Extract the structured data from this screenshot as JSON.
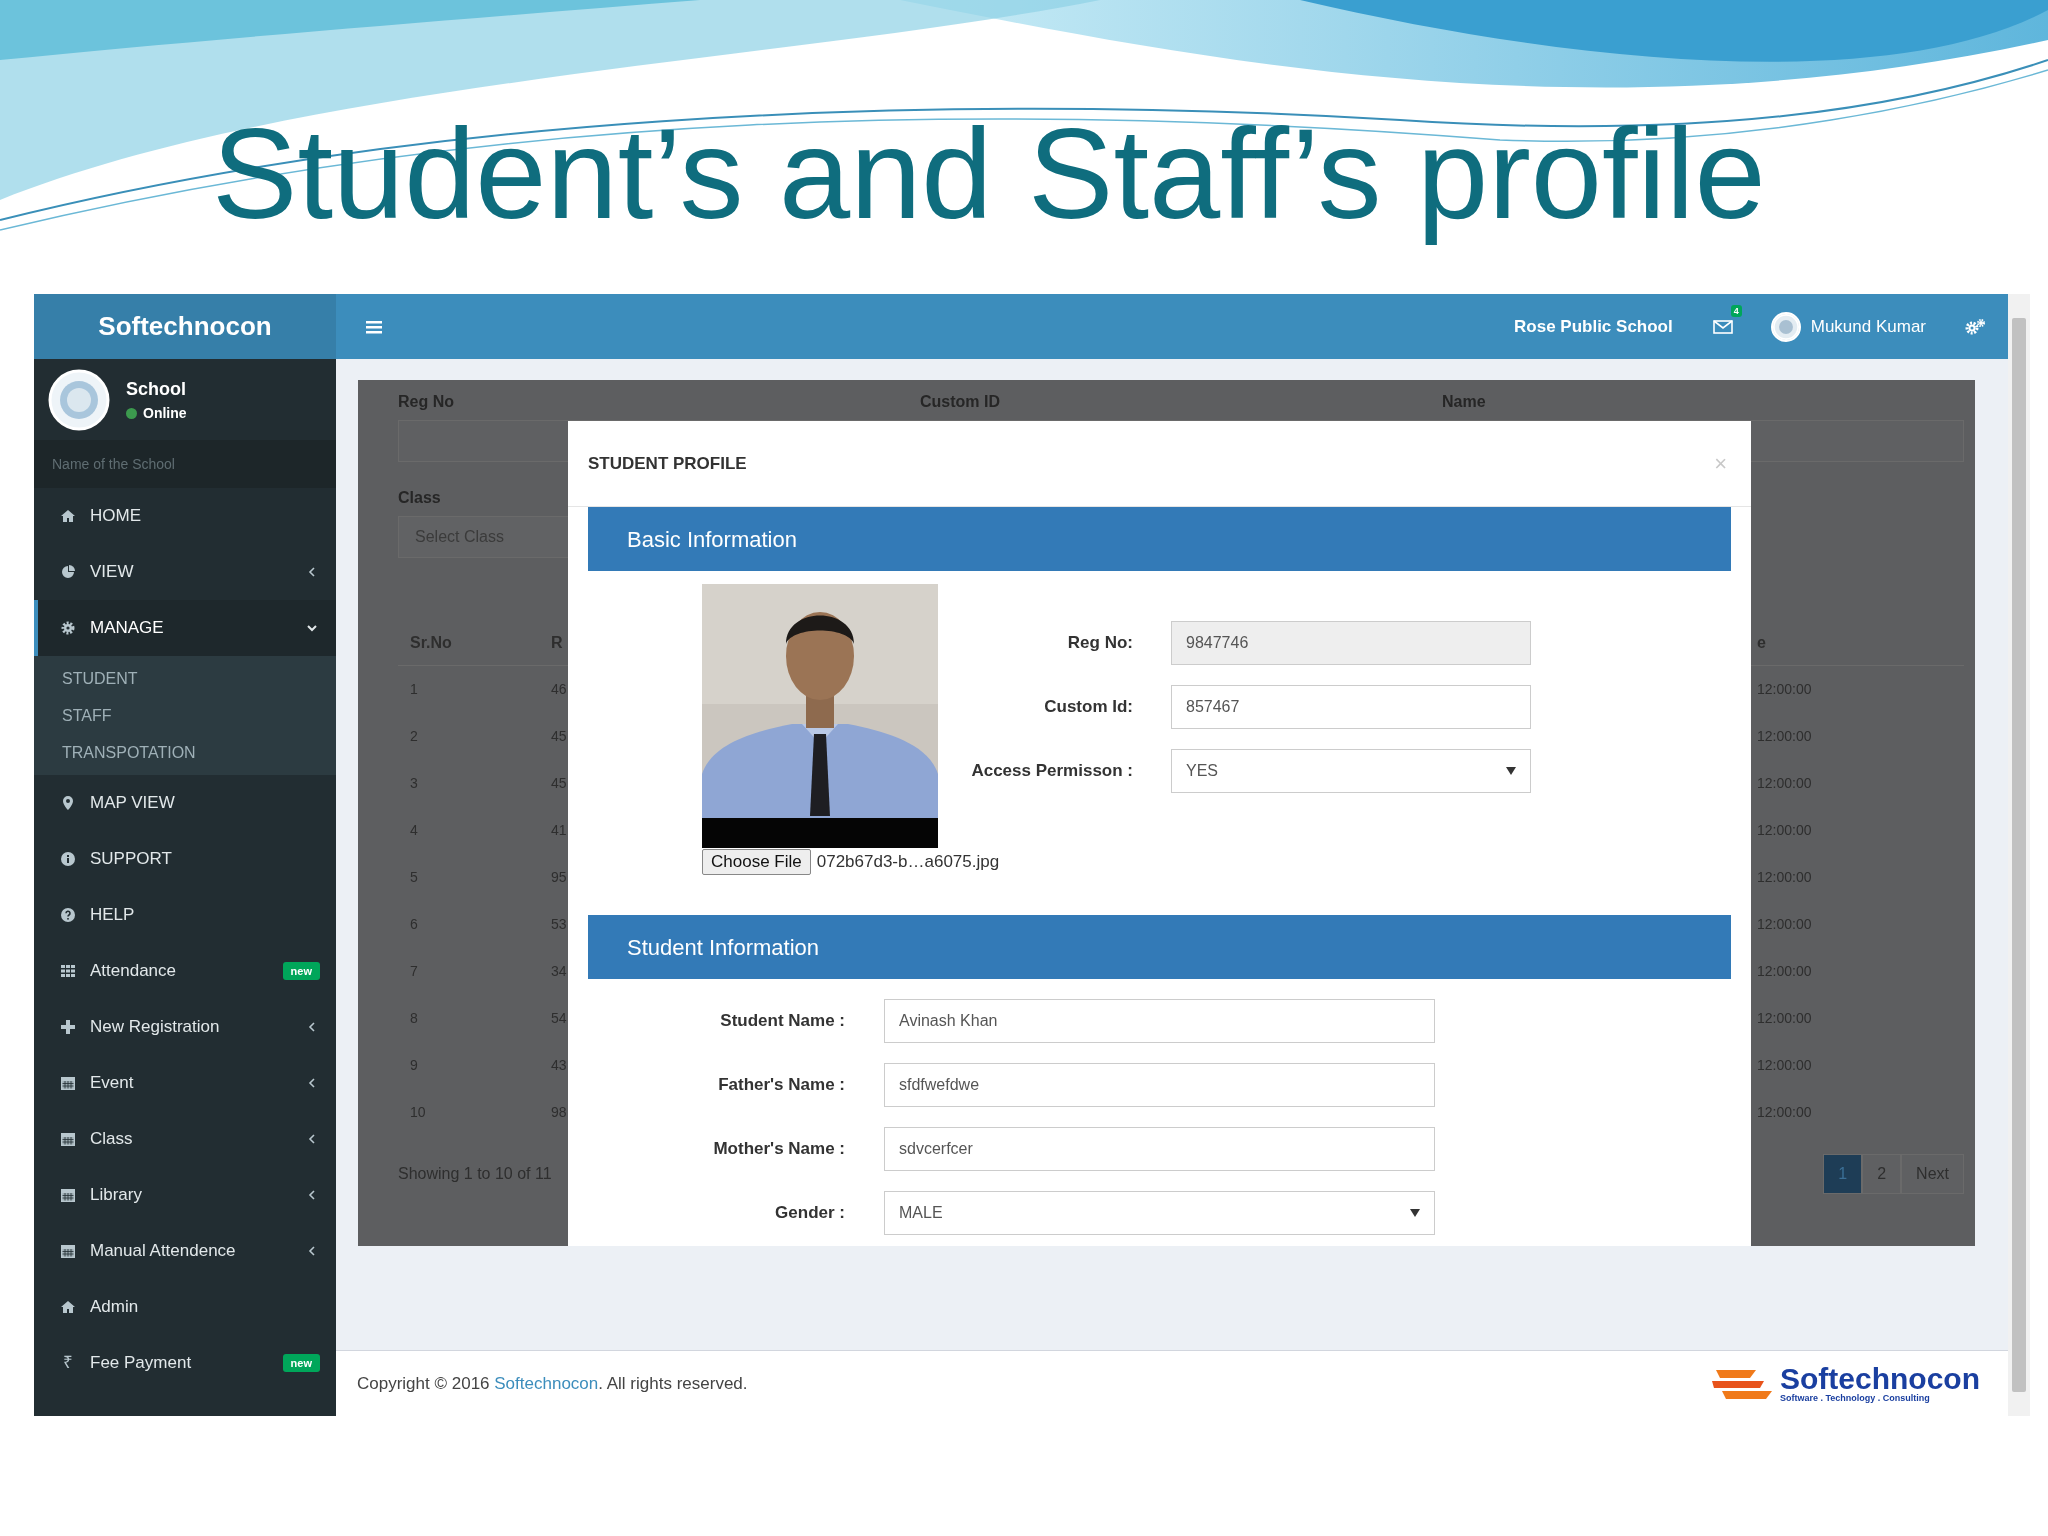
{
  "slide": {
    "title": "Student’s and Staff’s profile"
  },
  "brand": "Softechnocon",
  "topbar": {
    "school": "Rose Public School",
    "mail_count": "4",
    "user": "Mukund Kumar"
  },
  "sidebar": {
    "user": "School",
    "status": "Online",
    "search": {
      "placeholder": "Name of the School"
    },
    "items": [
      {
        "label": "HOME",
        "kind": "home",
        "selected": false
      },
      {
        "label": "VIEW",
        "kind": "pie",
        "selected": false,
        "expanded": false
      },
      {
        "label": "MANAGE",
        "kind": "gear",
        "selected": true,
        "expanded": true,
        "children": [
          {
            "label": "STUDENT"
          },
          {
            "label": "STAFF"
          },
          {
            "label": "TRANSPOTATION"
          }
        ]
      },
      {
        "label": "MAP VIEW",
        "kind": "pin",
        "selected": false
      },
      {
        "label": "SUPPORT",
        "kind": "info",
        "selected": false
      },
      {
        "label": "HELP",
        "kind": "question",
        "selected": false
      },
      {
        "label": "Attendance",
        "kind": "grid",
        "selected": false,
        "badge": "new"
      },
      {
        "label": "New Registration",
        "kind": "plus",
        "selected": false,
        "expanded": false
      },
      {
        "label": "Event",
        "kind": "calendar",
        "selected": false,
        "expanded": false
      },
      {
        "label": "Class",
        "kind": "calendar",
        "selected": false,
        "expanded": false
      },
      {
        "label": "Library",
        "kind": "calendar",
        "selected": false,
        "expanded": false
      },
      {
        "label": "Manual Attendence",
        "kind": "calendar",
        "selected": false,
        "expanded": false
      },
      {
        "label": "Admin",
        "kind": "home",
        "selected": false
      },
      {
        "label": "Fee Payment",
        "kind": "glyph",
        "glyph": "₹",
        "selected": false,
        "badge": "new"
      }
    ]
  },
  "search_form": {
    "labels": [
      "Reg No",
      "Custom ID",
      "Name"
    ],
    "class_label": "Class",
    "class_select": {
      "placeholder": "Select Class"
    }
  },
  "table": {
    "columns": [
      "Sr.No",
      "R",
      "e"
    ],
    "rows": [
      [
        "1",
        "46",
        "12:00:00"
      ],
      [
        "2",
        "45",
        "12:00:00"
      ],
      [
        "3",
        "45",
        "12:00:00"
      ],
      [
        "4",
        "41",
        "12:00:00"
      ],
      [
        "5",
        "95",
        "12:00:00"
      ],
      [
        "6",
        "53",
        "12:00:00"
      ],
      [
        "7",
        "34",
        "12:00:00"
      ],
      [
        "8",
        "54",
        "12:00:00"
      ],
      [
        "9",
        "43",
        "12:00:00"
      ],
      [
        "10",
        "98",
        "12:00:00"
      ]
    ],
    "info": "Showing 1 to 10 of 11",
    "pages": [
      {
        "label": "1",
        "selected": true
      },
      {
        "label": "2",
        "selected": false
      },
      {
        "label": "Next",
        "selected": false
      }
    ]
  },
  "modal": {
    "title": "STUDENT PROFILE",
    "close": "×",
    "basic": {
      "header": "Basic Information",
      "file_button": "Choose File",
      "file_name": "072b67d3-b…a6075.jpg",
      "fields": [
        {
          "label": "Reg No:",
          "value": "9847746",
          "kind": "input",
          "disabled": true
        },
        {
          "label": "Custom Id:",
          "value": "857467",
          "kind": "input",
          "disabled": false
        },
        {
          "label": "Access Permisson :",
          "value": "YES",
          "kind": "select",
          "disabled": false
        }
      ]
    },
    "student": {
      "header": "Student Information",
      "fields": [
        {
          "label": "Student Name :",
          "value": "Avinash Khan",
          "kind": "input",
          "disabled": false
        },
        {
          "label": "Father's Name :",
          "value": "sfdfwefdwe",
          "kind": "input",
          "disabled": false
        },
        {
          "label": "Mother's Name :",
          "value": "sdvcerfcer",
          "kind": "input",
          "disabled": false
        },
        {
          "label": "Gender :",
          "value": "MALE",
          "kind": "select",
          "disabled": false
        }
      ]
    }
  },
  "footer": {
    "prefix": "Copyright © 2016 ",
    "link": "Softechnocon",
    "suffix": ". All rights reserved.",
    "logo_name": "Softechnocon",
    "logo_tagline": "Software . Technology . Consulting"
  }
}
